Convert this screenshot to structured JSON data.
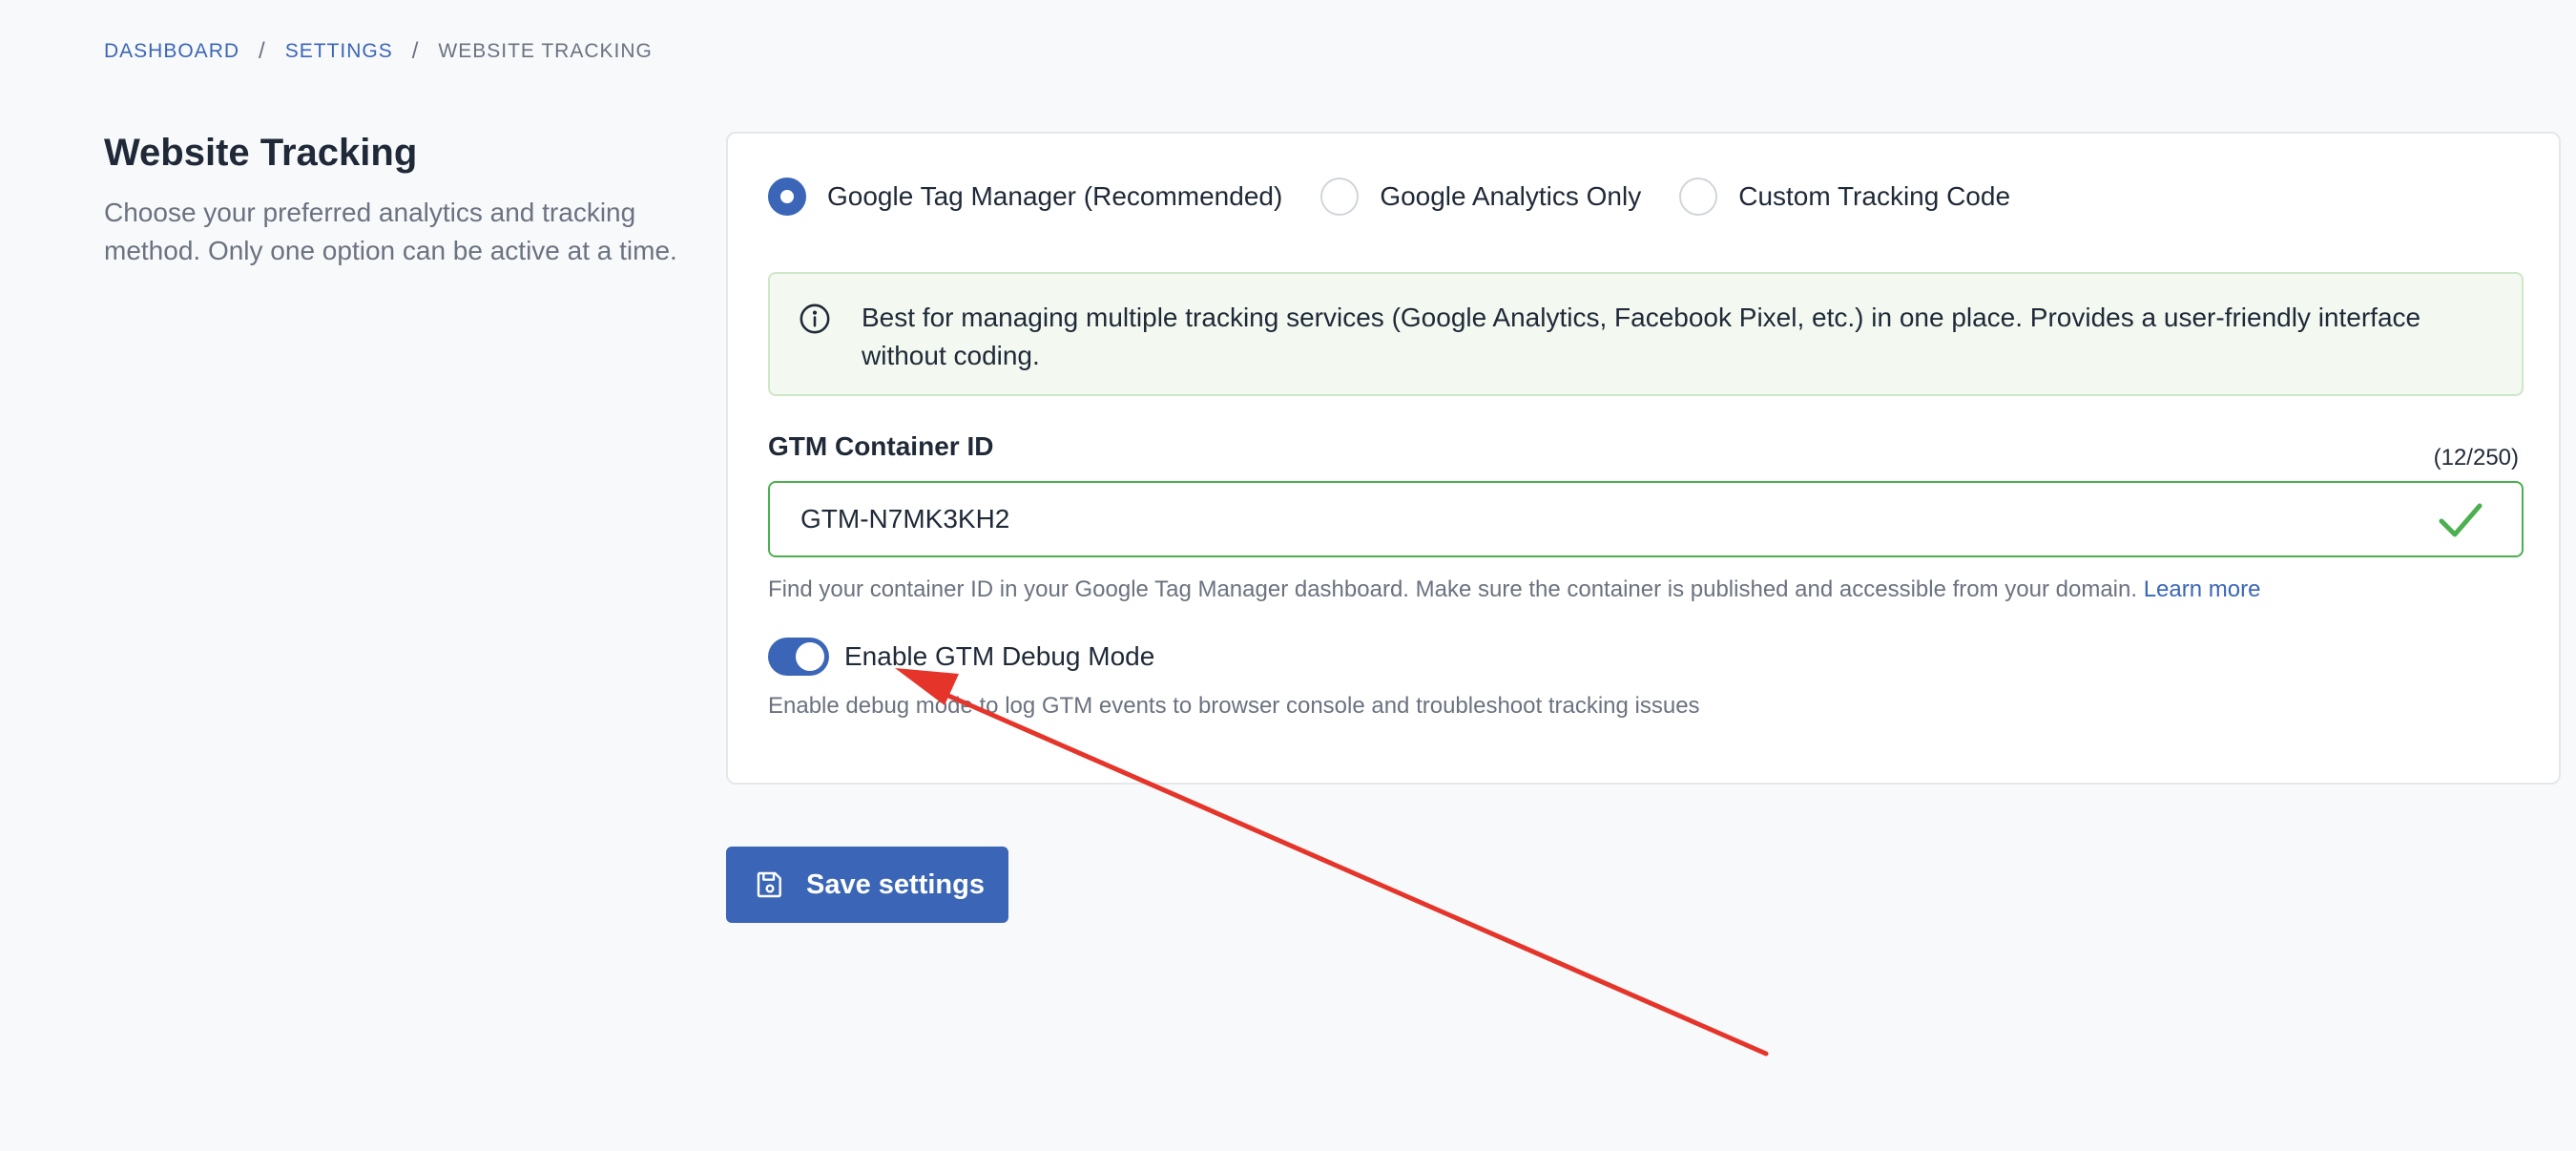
{
  "breadcrumb": {
    "items": [
      "DASHBOARD",
      "SETTINGS",
      "WEBSITE TRACKING"
    ],
    "separator": "/"
  },
  "intro": {
    "title": "Website Tracking",
    "description": "Choose your preferred analytics and tracking method. Only one option can be active at a time."
  },
  "tracking_options": {
    "selected": "Google Tag Manager (Recommended)",
    "options": [
      "Google Tag Manager (Recommended)",
      "Google Analytics Only",
      "Custom Tracking Code"
    ]
  },
  "info_box": {
    "icon": "info-circle-icon",
    "text": "Best for managing multiple tracking services (Google Analytics, Facebook Pixel, etc.) in one place. Provides a user-friendly interface without coding."
  },
  "gtm_field": {
    "label": "GTM Container ID",
    "char_count": "(12/250)",
    "value": "GTM-N7MK3KH2",
    "valid_icon": "checkmark-icon",
    "help_text": "Find your container ID in your Google Tag Manager dashboard. Make sure the container is published and accessible from your domain.",
    "help_link": "Learn more"
  },
  "debug_toggle": {
    "label": "Enable GTM Debug Mode",
    "enabled": true,
    "help_text": "Enable debug mode to log GTM events to browser console and troubleshoot tracking issues"
  },
  "save_button": {
    "label": "Save settings",
    "icon": "floppy-disk-icon"
  },
  "colors": {
    "accent": "#3b66b7",
    "success": "#4caf50",
    "info_bg": "#f3f9f1",
    "annotation": "#e5352b"
  }
}
